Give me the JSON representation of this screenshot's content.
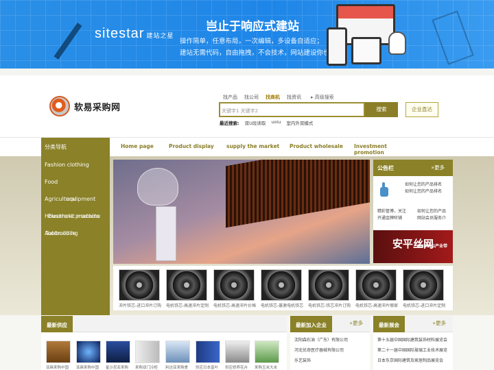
{
  "banner": {
    "logo": "sitestar",
    "logo_sub": "建站之星",
    "headline": "岂止于响应式建站",
    "line1": "操作简单，任意布局，一次编辑，多设备自适应；",
    "line2": "建站无需代码，自由拖拽，不会技术，网站建设你也行!"
  },
  "site": {
    "name": "软易采购网"
  },
  "search": {
    "tabs": [
      "找产品",
      "找公司",
      "找商机",
      "找资讯"
    ],
    "active_tab": "找商机",
    "advanced": "高级搜索",
    "placeholder": "关键字1 关键字2",
    "button": "搜索",
    "enterprise_button": "企业直达",
    "hot_label": "最近搜索:",
    "hot_terms": [
      "双U段读取",
      "uoiu",
      "室内外双模式"
    ]
  },
  "nav": {
    "category_title": "分类导航",
    "links": [
      "Home page",
      "Product display",
      "supply the market",
      "Product wholesale",
      "Investment promotion"
    ]
  },
  "categories": [
    "Fashion clothing",
    "Food",
    "Agricultural",
    "Household products",
    "Automobile",
    "equipment",
    "Electronic machine",
    "Toolbuilding"
  ],
  "notice": {
    "title": "公告栏",
    "more": "»更多",
    "items": [
      "如何让您的产品排名",
      "如何让您的产品排名",
      "精彩管博，关注",
      "如何让您的产品",
      "开通金牌旺铺",
      "网站会员服务介"
    ]
  },
  "ad": {
    "text": "安平丝网",
    "sub": "ANPING产业带"
  },
  "products": [
    "冲片铁芯-进口冲片订购",
    "电机铁芯-高速冲片定制",
    "电机铁芯-高速冲片价格",
    "电机铁芯-暴激电机铁芯",
    "电机铁芯-铁芯冲片订购",
    "电机铁芯-高速冲片哪家",
    "电机铁芯-进口冲片定制"
  ],
  "supply": {
    "title": "最新供应",
    "items": [
      "亚麻来购中国",
      "亚麻来购中国",
      "星沙尼亚来购",
      "来购双门冷柜",
      "利达亚来购食",
      "供应日本富叶",
      "供应修养花卉",
      "来购玉米大米"
    ]
  },
  "enterprises": {
    "title": "最新加入企业",
    "more": "»更多",
    "items": [
      "沈阳森石油（广东）有限公司",
      "河北优奇医疗器械有限公司",
      "乐艺装饰"
    ]
  },
  "exhibitions": {
    "title": "最新展会",
    "more": "»更多",
    "items": [
      "第十五届中国国际建筑装饰材料展览会",
      "第二十一届中国国际玻璃工业技术展览",
      "日本东京国际建筑及家居制品展览会"
    ]
  }
}
